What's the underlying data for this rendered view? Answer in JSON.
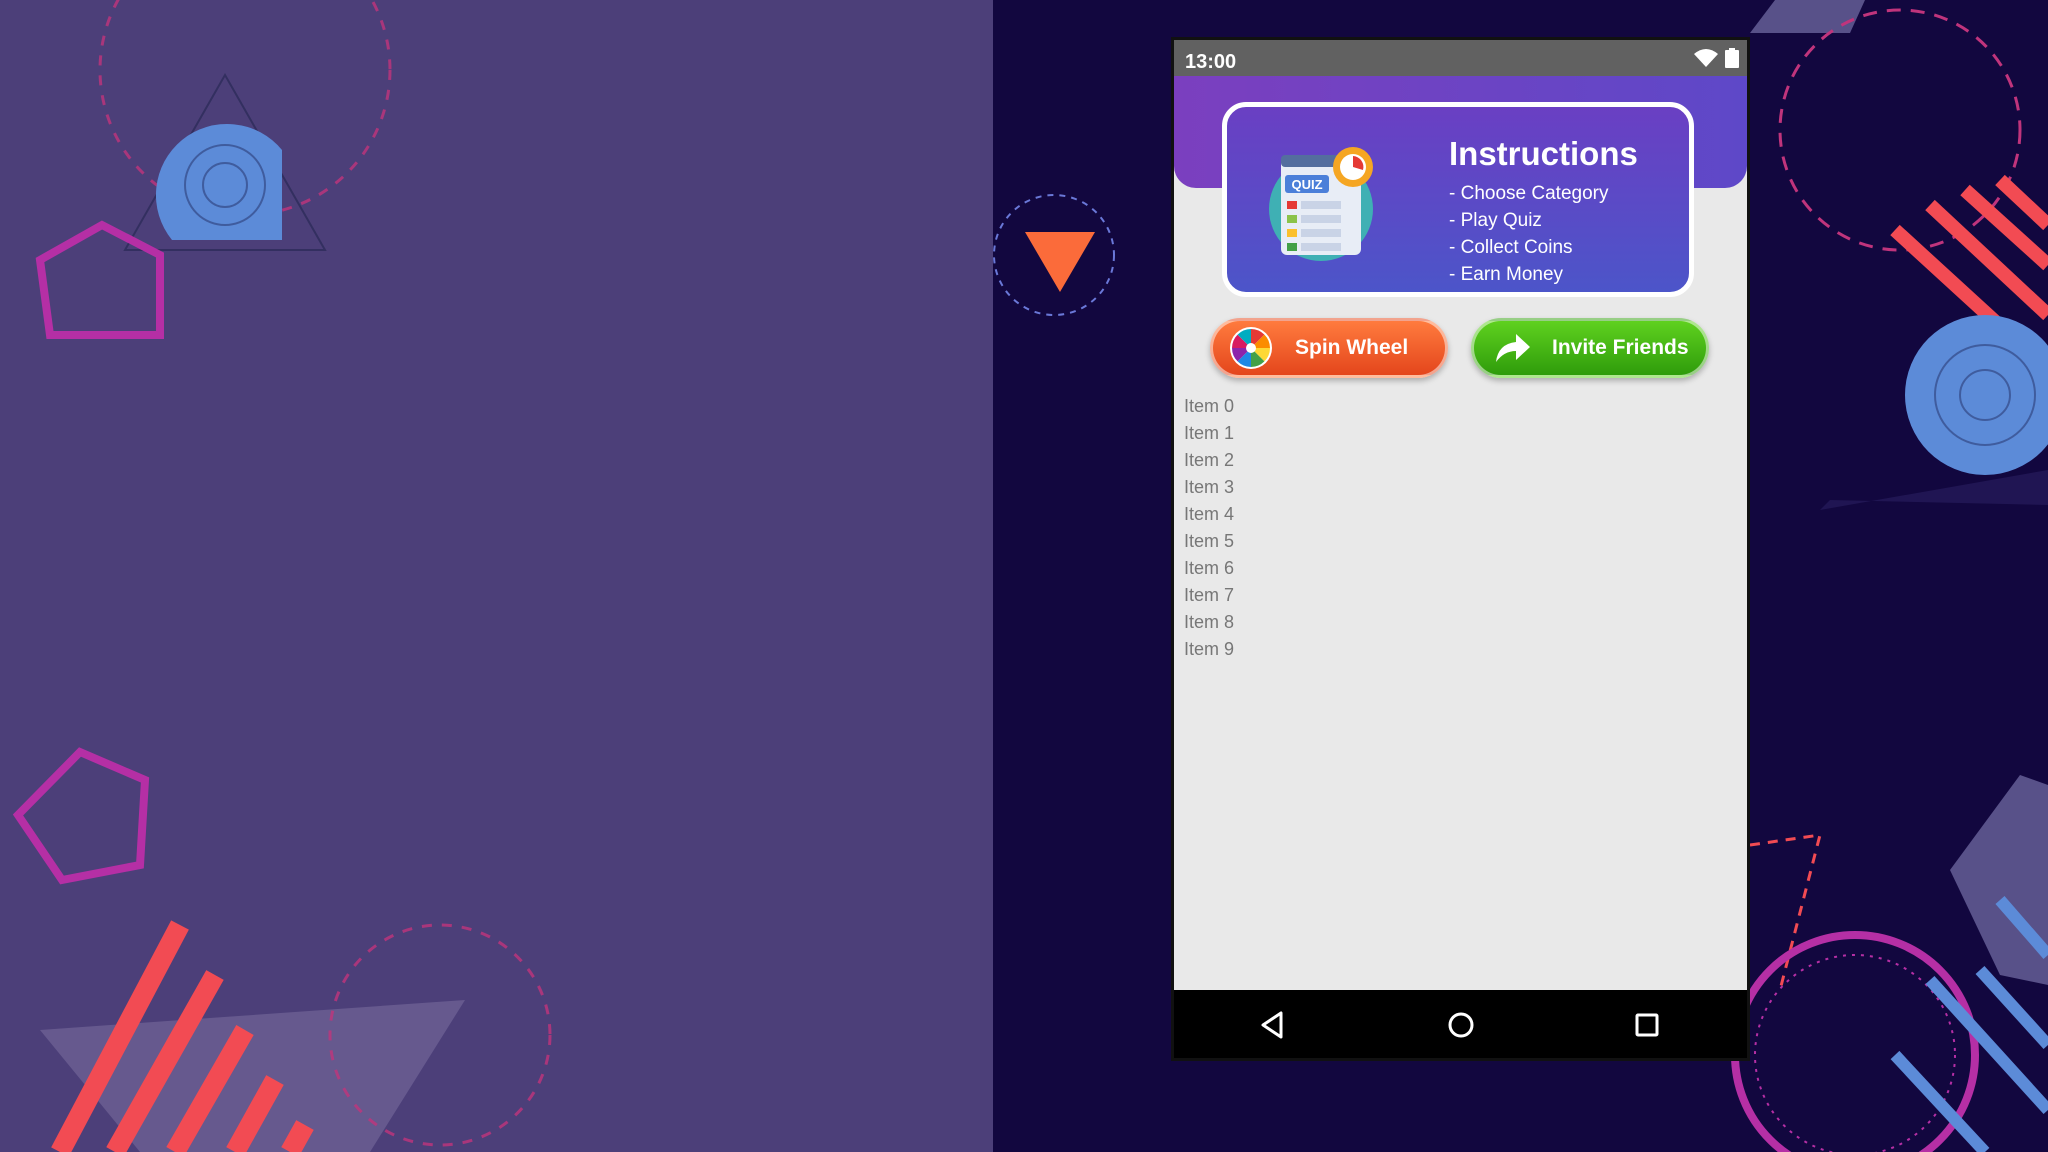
{
  "status_bar": {
    "time": "13:00"
  },
  "instructions": {
    "title": "Instructions",
    "items": [
      "- Choose Category",
      "- Play Quiz",
      "- Collect Coins",
      "- Earn Money"
    ],
    "badge_text": "QUIZ"
  },
  "buttons": {
    "spin_wheel": "Spin Wheel",
    "invite_friends": "Invite Friends"
  },
  "list_items": [
    "Item 0",
    "Item 1",
    "Item 2",
    "Item 3",
    "Item 4",
    "Item 5",
    "Item 6",
    "Item 7",
    "Item 8",
    "Item 9"
  ],
  "colors": {
    "spin_button": "#e4461c",
    "invite_button": "#2f9c0b",
    "header": "#6a3fc3",
    "background_left": "#4c3f79",
    "background_right": "#12073f"
  },
  "icons": {
    "spin": "color-wheel-icon",
    "invite": "share-arrow-icon",
    "nav_back": "triangle-back-icon",
    "nav_home": "circle-home-icon",
    "nav_recent": "square-recent-icon"
  }
}
